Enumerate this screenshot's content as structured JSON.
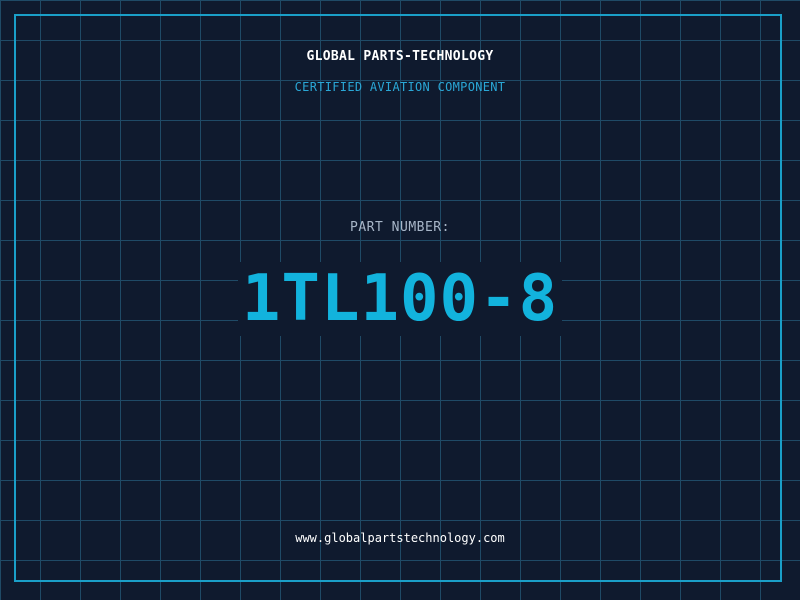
{
  "header": {
    "company": "GLOBAL PARTS-TECHNOLOGY",
    "tagline": "CERTIFIED AVIATION COMPONENT"
  },
  "part": {
    "label": "PART NUMBER:",
    "number": "1TL100-8"
  },
  "footer": {
    "url": "www.globalpartstechnology.com"
  },
  "colors": {
    "background": "#0f1a2e",
    "grid": "#1f4a66",
    "accent": "#12b3dd",
    "frame": "#1a9fc8"
  }
}
